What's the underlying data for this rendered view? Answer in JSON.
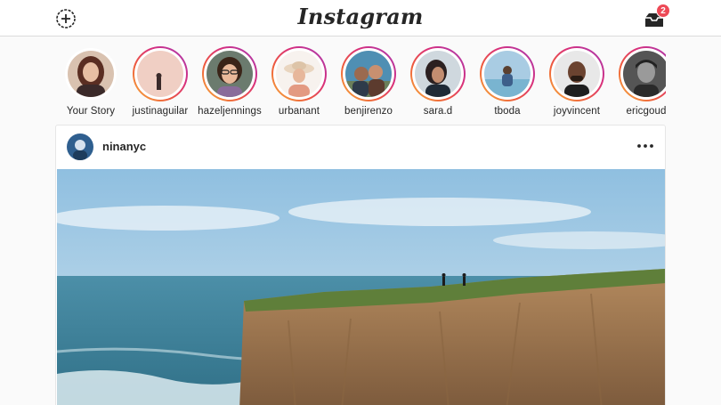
{
  "header": {
    "logo_text": "Instagram",
    "new_post_icon": "plus-circle-icon",
    "inbox_icon": "inbox-tray-icon",
    "inbox_badge": "2"
  },
  "stories": [
    {
      "name": "Your Story"
    },
    {
      "name": "justinaguilar"
    },
    {
      "name": "hazeljennings"
    },
    {
      "name": "urbanant"
    },
    {
      "name": "benjirenzo"
    },
    {
      "name": "sara.d"
    },
    {
      "name": "tboda"
    },
    {
      "name": "joyvincent"
    },
    {
      "name": "ericgoud"
    }
  ],
  "post": {
    "username": "ninanyc",
    "more_icon": "more-horizontal-icon"
  },
  "colors": {
    "badge": "#ed4956",
    "story_ring_start": "#f7b33b",
    "story_ring_end": "#a13db7"
  }
}
